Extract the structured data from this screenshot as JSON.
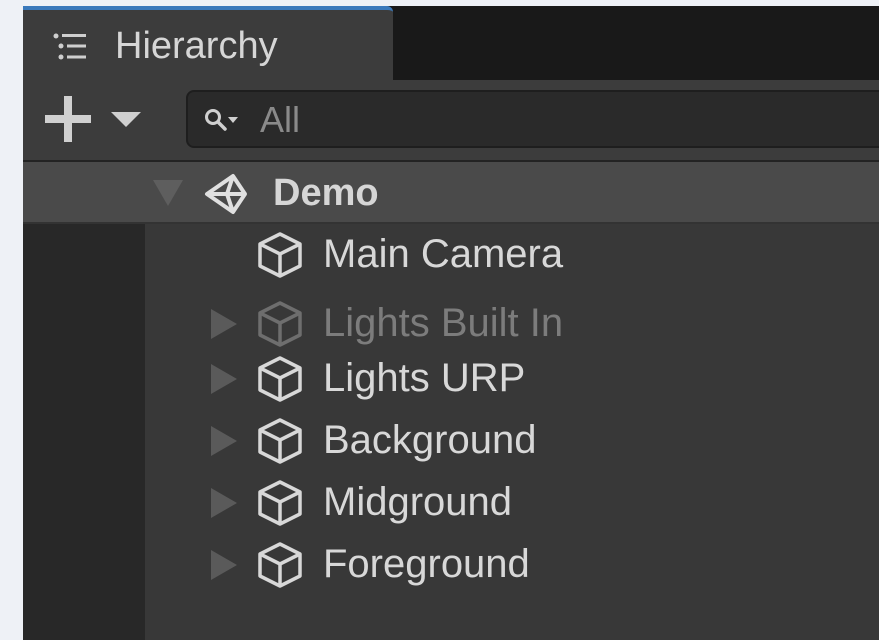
{
  "window": {
    "tab_label": "Hierarchy"
  },
  "toolbar": {
    "add_icon": "plus-icon",
    "dropdown_icon": "caret-down-icon",
    "search": {
      "placeholder": "All",
      "value": ""
    }
  },
  "colors": {
    "panel_bg": "#282828",
    "tab_accent": "#3a79bb",
    "selected_row": "#4a4a4a",
    "text": "#d6d6d6",
    "disabled_text": "#7c7c7c"
  },
  "scene": {
    "label": "Demo",
    "icon": "unity-scene-icon",
    "expanded": true
  },
  "items": [
    {
      "label": "Main Camera",
      "has_children": false,
      "active": true,
      "icon": "gameobject-cube-icon"
    },
    {
      "label": "Lights Built In",
      "has_children": true,
      "active": false,
      "icon": "gameobject-cube-icon"
    },
    {
      "label": "Lights URP",
      "has_children": true,
      "active": true,
      "icon": "gameobject-cube-icon"
    },
    {
      "label": "Background",
      "has_children": true,
      "active": true,
      "icon": "gameobject-cube-icon"
    },
    {
      "label": "Midground",
      "has_children": true,
      "active": true,
      "icon": "gameobject-cube-icon"
    },
    {
      "label": "Foreground",
      "has_children": true,
      "active": true,
      "icon": "gameobject-cube-icon"
    }
  ]
}
